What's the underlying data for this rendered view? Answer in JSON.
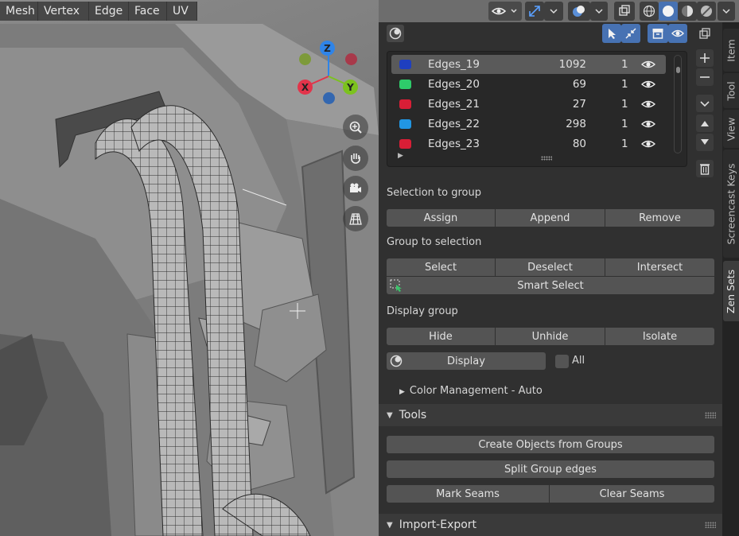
{
  "header": {
    "menus": [
      "Mesh",
      "Vertex",
      "Edge",
      "Face",
      "UV"
    ]
  },
  "gizmo": {
    "z": "Z",
    "x": "X",
    "y": "Y"
  },
  "icons": {
    "overlay": "eye-overlay-icon",
    "gizmo": "transform-gizmo-icon",
    "viewport_shading": "shading-icons",
    "zoom": "zoom-icon",
    "pan": "hand-icon",
    "camera": "camera-icon",
    "ortho": "grid-icon"
  },
  "colors": {
    "accent": "#4772b3",
    "panel": "#303030"
  },
  "groups": [
    {
      "name": "Edges_19",
      "count": "1092",
      "users": "1",
      "color": "#1f3fbf",
      "selected": true
    },
    {
      "name": "Edges_20",
      "count": "69",
      "users": "1",
      "color": "#2ecc6a",
      "selected": false
    },
    {
      "name": "Edges_21",
      "count": "27",
      "users": "1",
      "color": "#d91e36",
      "selected": false
    },
    {
      "name": "Edges_22",
      "count": "298",
      "users": "1",
      "color": "#2196e3",
      "selected": false
    },
    {
      "name": "Edges_23",
      "count": "80",
      "users": "1",
      "color": "#d91e36",
      "selected": false
    }
  ],
  "selection_to_group": {
    "label": "Selection to group",
    "assign": "Assign",
    "append": "Append",
    "remove": "Remove"
  },
  "group_to_selection": {
    "label": "Group to selection",
    "select": "Select",
    "deselect": "Deselect",
    "intersect": "Intersect",
    "smart_select": "Smart Select"
  },
  "display_group": {
    "label": "Display group",
    "hide": "Hide",
    "unhide": "Unhide",
    "isolate": "Isolate",
    "display": "Display",
    "all": "All"
  },
  "color_management": "Color Management - Auto",
  "tools": {
    "title": "Tools",
    "create_objects": "Create Objects from Groups",
    "split_edges": "Split Group edges",
    "mark_seams": "Mark Seams",
    "clear_seams": "Clear Seams"
  },
  "import_export": {
    "title": "Import-Export"
  },
  "tabs": [
    "Item",
    "Tool",
    "View",
    "Screencast Keys",
    "Zen Sets"
  ]
}
